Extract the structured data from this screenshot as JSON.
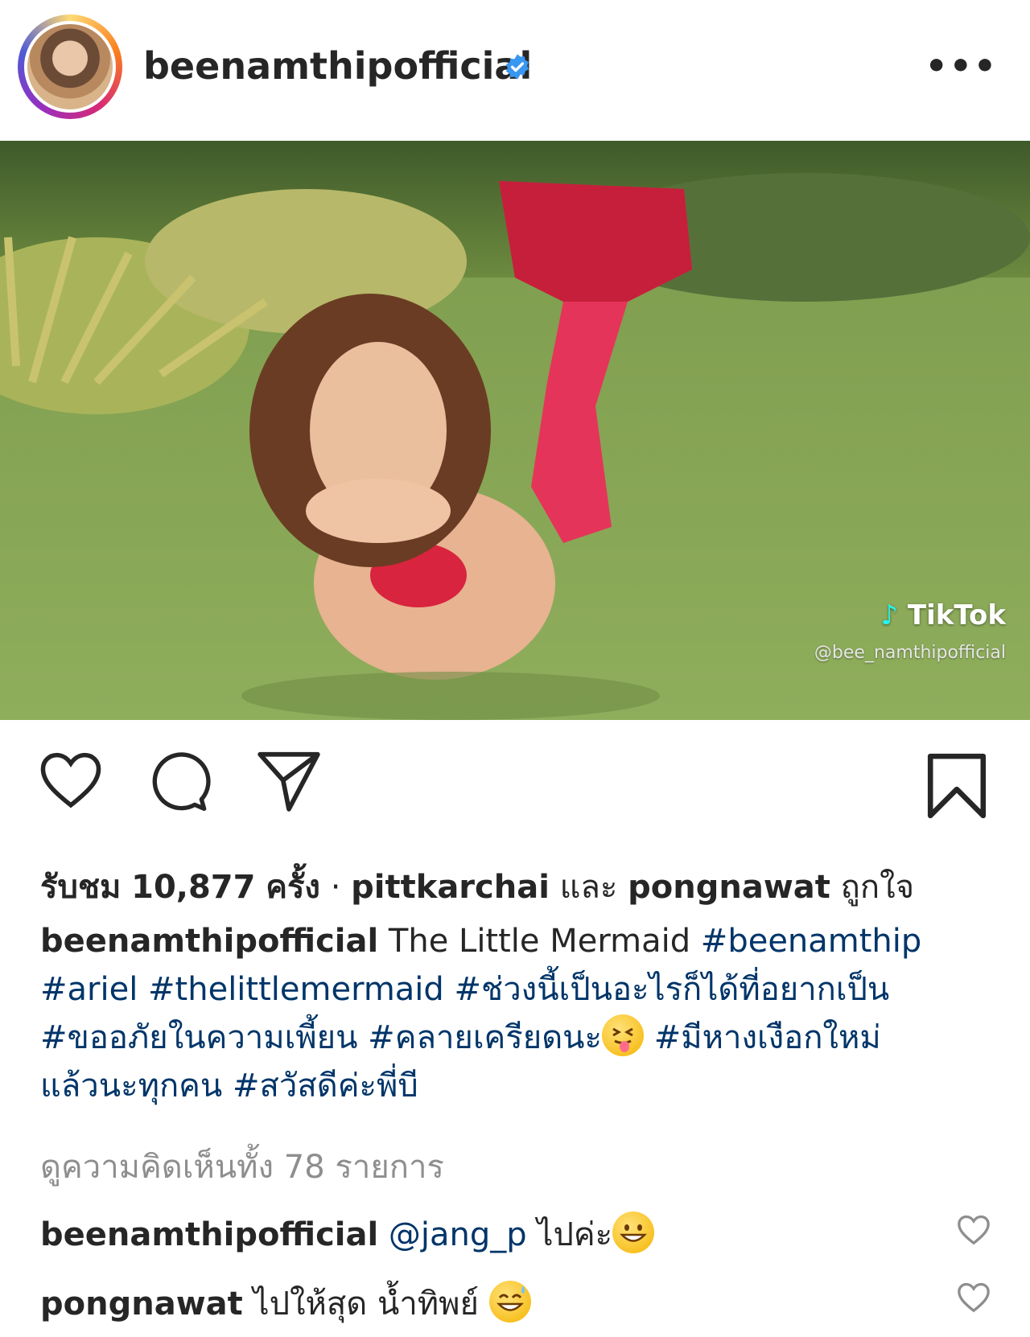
{
  "header": {
    "username": "beenamthipofficial",
    "verified_icon": "verified-badge-icon",
    "more_label": "•••"
  },
  "media": {
    "watermark_brand": "TikTok",
    "watermark_handle": "@bee_namthipofficial"
  },
  "actions": {
    "like_icon": "heart-icon",
    "comment_icon": "comment-bubble-icon",
    "share_icon": "paper-plane-icon",
    "save_icon": "bookmark-icon"
  },
  "stats": {
    "views_prefix": "รับชม",
    "views_count": "10,877",
    "views_suffix": "ครั้ง",
    "separator": "·",
    "liker1": "pittkarchai",
    "conjunction": "และ",
    "liker2": "pongnawat",
    "liked_suffix": "ถูกใจ"
  },
  "caption": {
    "username": "beenamthipofficial",
    "text": "The Little Mermaid",
    "tags_line1": [
      "#beenamthip"
    ],
    "tags_line2": [
      "#ariel",
      "#thelittlemermaid",
      "#ช่วงนี้เป็นอะไรก็ได้ที่อยากเป็น"
    ],
    "tags_line3": [
      "#ขออภัยในความเพี้ยน",
      "#คลายเครียดนะ"
    ],
    "tags_line3b": "#มีหางเงือกใหม่",
    "line4_text": "แล้วนะทุกคน",
    "tags_line4": "#สวัสดีค่ะพี่บี"
  },
  "view_comments": "ดูความคิดเห็นทั้ง 78 รายการ",
  "comments": [
    {
      "username": "beenamthipofficial",
      "mention": "@jang_p",
      "text": "ไปค่ะ"
    },
    {
      "username": "pongnawat",
      "text": "ไปให้สุด น้ำทิพย์"
    }
  ],
  "colors": {
    "text": "#262626",
    "hashtag": "#003569",
    "muted": "#8e8e8e",
    "verified": "#3897f0"
  }
}
